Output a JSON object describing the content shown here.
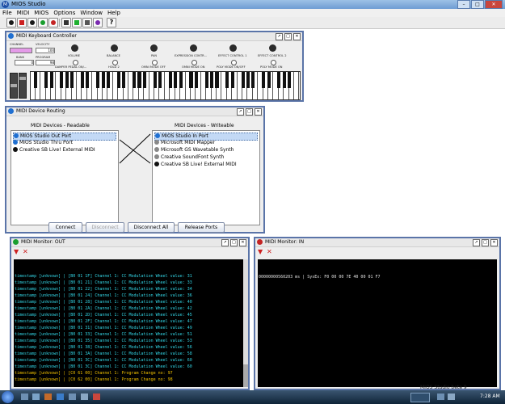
{
  "app": {
    "title": "MIOS Studio"
  },
  "menu": [
    "File",
    "MIDI",
    "MIOS",
    "Options",
    "Window",
    "Help"
  ],
  "toolbar": {
    "help_label": "?"
  },
  "keyboard": {
    "title": "MIDI Keyboard Controller",
    "channel_label": "CHANNEL",
    "velocity_label": "VELOCITY",
    "velocity_value": "100",
    "bank_label": "BANK",
    "bank_value": "0",
    "program_label": "PROGRAM",
    "program_value": "98",
    "knobs": [
      {
        "label": "VOLUME"
      },
      {
        "label": "BALANCE"
      },
      {
        "label": "PAN"
      },
      {
        "label": "EXPRESSION CONTR..."
      },
      {
        "label": "EFFECT CONTROL 1"
      },
      {
        "label": "EFFECT CONTROL 2"
      }
    ],
    "buttons": [
      {
        "label": "DAMPER PEDAL ON/..."
      },
      {
        "label": "HOLD 2"
      },
      {
        "label": "OMNI MODE OFF"
      },
      {
        "label": "OMNI MODE ON"
      },
      {
        "label": "POLY MODE ON/OFF"
      },
      {
        "label": "POLY MODE ON"
      }
    ]
  },
  "routing": {
    "title": "MIDI Device Routing",
    "readable_header": "MIDI Devices - Readable",
    "writeable_header": "MIDI Devices - Writeable",
    "readable": [
      {
        "label": "MIOS Studio Out Port",
        "color": "#1f6fd1",
        "selected": true
      },
      {
        "label": "MIOS Studio Thru Port",
        "color": "#1f6fd1",
        "selected": false
      },
      {
        "label": "Creative SB Live! External MIDI",
        "color": "#111111",
        "selected": false
      }
    ],
    "writeable": [
      {
        "label": "MIOS Studio In Port",
        "color": "#1f6fd1",
        "selected": true
      },
      {
        "label": "Microsoft MIDI Mapper",
        "color": "#888888",
        "selected": false
      },
      {
        "label": "Microsoft GS Wavetable Synth",
        "color": "#888888",
        "selected": false
      },
      {
        "label": "Creative SoundFont Synth",
        "color": "#888888",
        "selected": false
      },
      {
        "label": "Creative SB Live! External MIDI",
        "color": "#111111",
        "selected": false
      }
    ],
    "buttons": {
      "connect": "Connect",
      "disconnect": "Disconnect",
      "disconnect_all": "Disconnect All",
      "release_ports": "Release Ports"
    }
  },
  "monitor_out": {
    "title": "MIDI Monitor: OUT",
    "lines": [
      {
        "text": "timestamp [unknown] | [B0 01 1F] Channel 1: CC Modulation Wheel value: 31",
        "color": "#33d6e6"
      },
      {
        "text": "timestamp [unknown] | [B0 01 21] Channel 1: CC Modulation Wheel value: 33",
        "color": "#33d6e6"
      },
      {
        "text": "timestamp [unknown] | [B0 01 22] Channel 1: CC Modulation Wheel value: 34",
        "color": "#33d6e6"
      },
      {
        "text": "timestamp [unknown] | [B0 01 24] Channel 1: CC Modulation Wheel value: 36",
        "color": "#33d6e6"
      },
      {
        "text": "timestamp [unknown] | [B0 01 28] Channel 1: CC Modulation Wheel value: 40",
        "color": "#33d6e6"
      },
      {
        "text": "timestamp [unknown] | [B0 01 2A] Channel 1: CC Modulation Wheel value: 42",
        "color": "#33d6e6"
      },
      {
        "text": "timestamp [unknown] | [B0 01 2D] Channel 1: CC Modulation Wheel value: 45",
        "color": "#33d6e6"
      },
      {
        "text": "timestamp [unknown] | [B0 01 2F] Channel 1: CC Modulation Wheel value: 47",
        "color": "#33d6e6"
      },
      {
        "text": "timestamp [unknown] | [B0 01 31] Channel 1: CC Modulation Wheel value: 49",
        "color": "#33d6e6"
      },
      {
        "text": "timestamp [unknown] | [B0 01 33] Channel 1: CC Modulation Wheel value: 51",
        "color": "#33d6e6"
      },
      {
        "text": "timestamp [unknown] | [B0 01 35] Channel 1: CC Modulation Wheel value: 53",
        "color": "#33d6e6"
      },
      {
        "text": "timestamp [unknown] | [B0 01 38] Channel 1: CC Modulation Wheel value: 56",
        "color": "#33d6e6"
      },
      {
        "text": "timestamp [unknown] | [B0 01 3A] Channel 1: CC Modulation Wheel value: 58",
        "color": "#33d6e6"
      },
      {
        "text": "timestamp [unknown] | [B0 01 3C] Channel 1: CC Modulation Wheel value: 60",
        "color": "#33d6e6"
      },
      {
        "text": "timestamp [unknown] | [B0 01 3C] Channel 1: CC Modulation Wheel value: 60",
        "color": "#33d6e6"
      },
      {
        "text": "timestamp [unknown] | [C0 61 00] Channel 1: Program Change no: 97",
        "color": "#f0c000"
      },
      {
        "text": "timestamp [unknown] | [C0 62 00] Channel 1: Program Change no: 98",
        "color": "#f0c000"
      }
    ]
  },
  "monitor_in": {
    "title": "MIDI Monitor: IN",
    "lines": [
      {
        "text": "00000000560203 ms | SysEx: F0 00 00 7E 40 00 01 F7",
        "color": "#e0e0e0"
      }
    ]
  },
  "status": {
    "version": "MIOS Studio beta 9"
  },
  "taskbar": {
    "clock": "7:28 AM"
  }
}
